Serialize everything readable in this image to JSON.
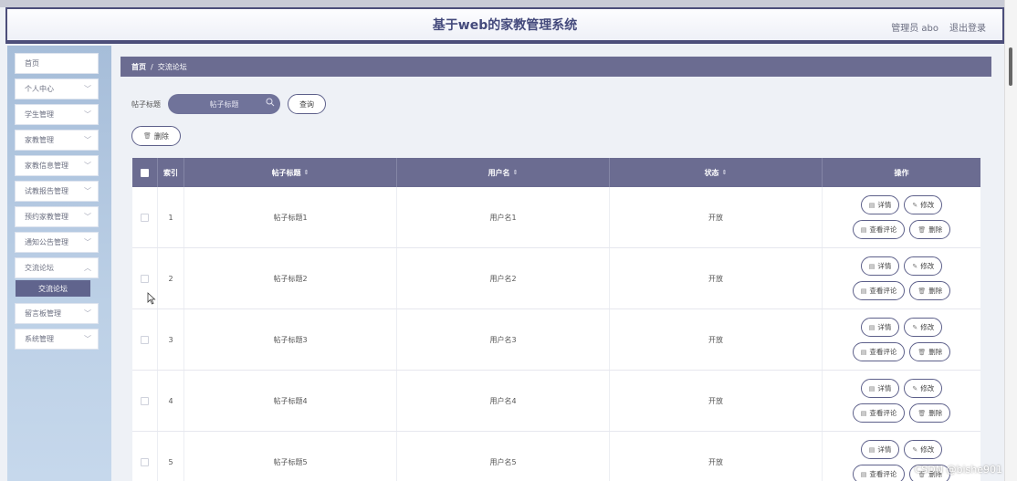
{
  "header": {
    "title": "基于web的家教管理系统",
    "user": "管理员 abo",
    "logout": "退出登录"
  },
  "sidebar": {
    "items": [
      {
        "label": "首页"
      },
      {
        "label": "个人中心"
      },
      {
        "label": "学生管理"
      },
      {
        "label": "家教管理"
      },
      {
        "label": "家教信息管理"
      },
      {
        "label": "试教报告管理"
      },
      {
        "label": "预约家教管理"
      },
      {
        "label": "通知公告管理"
      },
      {
        "label": "交流论坛"
      },
      {
        "label": "留言板管理"
      },
      {
        "label": "系统管理"
      }
    ],
    "active_sub": "交流论坛"
  },
  "breadcrumb": {
    "home": "首页",
    "sep": "/",
    "current": "交流论坛"
  },
  "search": {
    "label": "帖子标题",
    "placeholder": "帖子标题",
    "query_btn": "查询"
  },
  "toolbar": {
    "delete_btn": "删除"
  },
  "table": {
    "headers": {
      "index": "索引",
      "title": "帖子标题",
      "user": "用户名",
      "status": "状态",
      "ops": "操作"
    },
    "rows": [
      {
        "index": "1",
        "title": "帖子标题1",
        "user": "用户名1",
        "status": "开放"
      },
      {
        "index": "2",
        "title": "帖子标题2",
        "user": "用户名2",
        "status": "开放"
      },
      {
        "index": "3",
        "title": "帖子标题3",
        "user": "用户名3",
        "status": "开放"
      },
      {
        "index": "4",
        "title": "帖子标题4",
        "user": "用户名4",
        "status": "开放"
      },
      {
        "index": "5",
        "title": "帖子标题5",
        "user": "用户名5",
        "status": "开放"
      }
    ],
    "ops": {
      "detail": "详情",
      "edit": "修改",
      "comments": "查看评论",
      "delete": "删除"
    }
  },
  "watermark": "CSDN @bishe901"
}
